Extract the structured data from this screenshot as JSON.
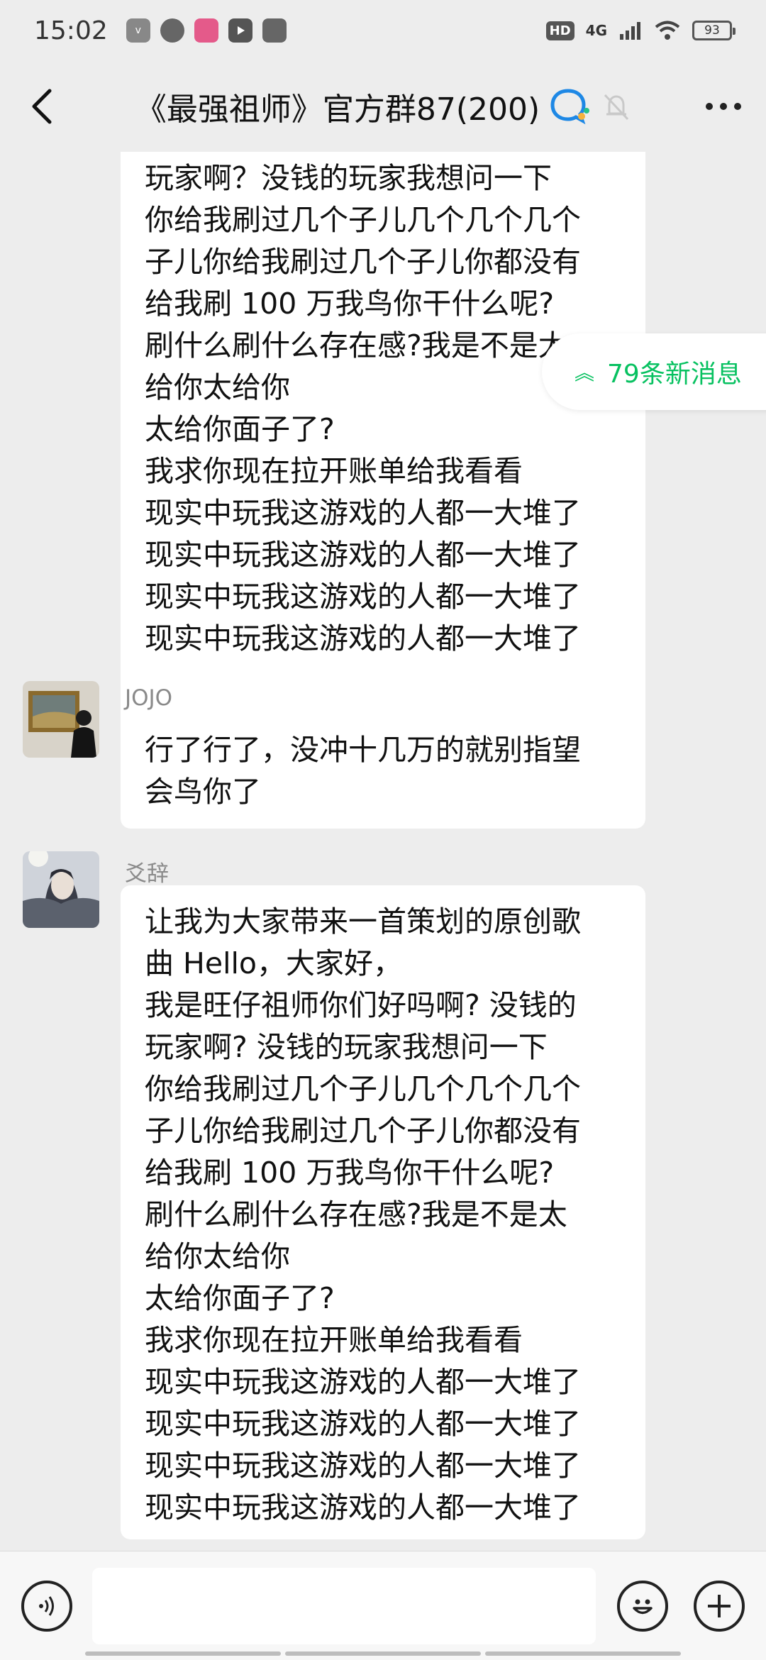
{
  "status_bar": {
    "time": "15:02",
    "hd_label": "HD",
    "network_label": "4G",
    "battery": "93"
  },
  "header": {
    "title": "《最强祖师》官方群87(200)"
  },
  "new_messages_pill": {
    "label": "79条新消息"
  },
  "messages": [
    {
      "sender": "",
      "text": "玩家啊？没钱的玩家我想问一下\n你给我刷过几个子儿几个几个几个\n子儿你给我刷过几个子儿你都没有\n给我刷 100 万我鸟你干什么呢?\n刷什么刷什么存在感?我是不是太\n给你太给你\n太给你面子了?\n我求你现在拉开账单给我看看\n现实中玩我这游戏的人都一大堆了\n现实中玩我这游戏的人都一大堆了\n现实中玩我这游戏的人都一大堆了\n现实中玩我这游戏的人都一大堆了"
    },
    {
      "sender": "JOJO",
      "text": "行了行了，没冲十几万的就别指望\n会鸟你了"
    },
    {
      "sender": "爻辞",
      "text": "让我为大家带来一首策划的原创歌\n曲 Hello，大家好，\n我是旺仔祖师你们好吗啊? 没钱的\n玩家啊? 没钱的玩家我想问一下\n你给我刷过几个子儿几个几个几个\n子儿你给我刷过几个子儿你都没有\n给我刷 100 万我鸟你干什么呢?\n刷什么刷什么存在感?我是不是太\n给你太给你\n太给你面子了?\n我求你现在拉开账单给我看看\n现实中玩我这游戏的人都一大堆了\n现实中玩我这游戏的人都一大堆了\n现实中玩我这游戏的人都一大堆了\n现实中玩我这游戏的人都一大堆了"
    }
  ],
  "input": {
    "placeholder": ""
  },
  "colors": {
    "background": "#ededed",
    "bubble": "#ffffff",
    "accent_green": "#07c160",
    "qq_blue": "#1e88e5"
  },
  "icons": [
    "back-arrow-icon",
    "chat-group-icon",
    "mute-bell-icon",
    "more-dots-icon",
    "voice-icon",
    "emoji-icon",
    "plus-icon"
  ]
}
